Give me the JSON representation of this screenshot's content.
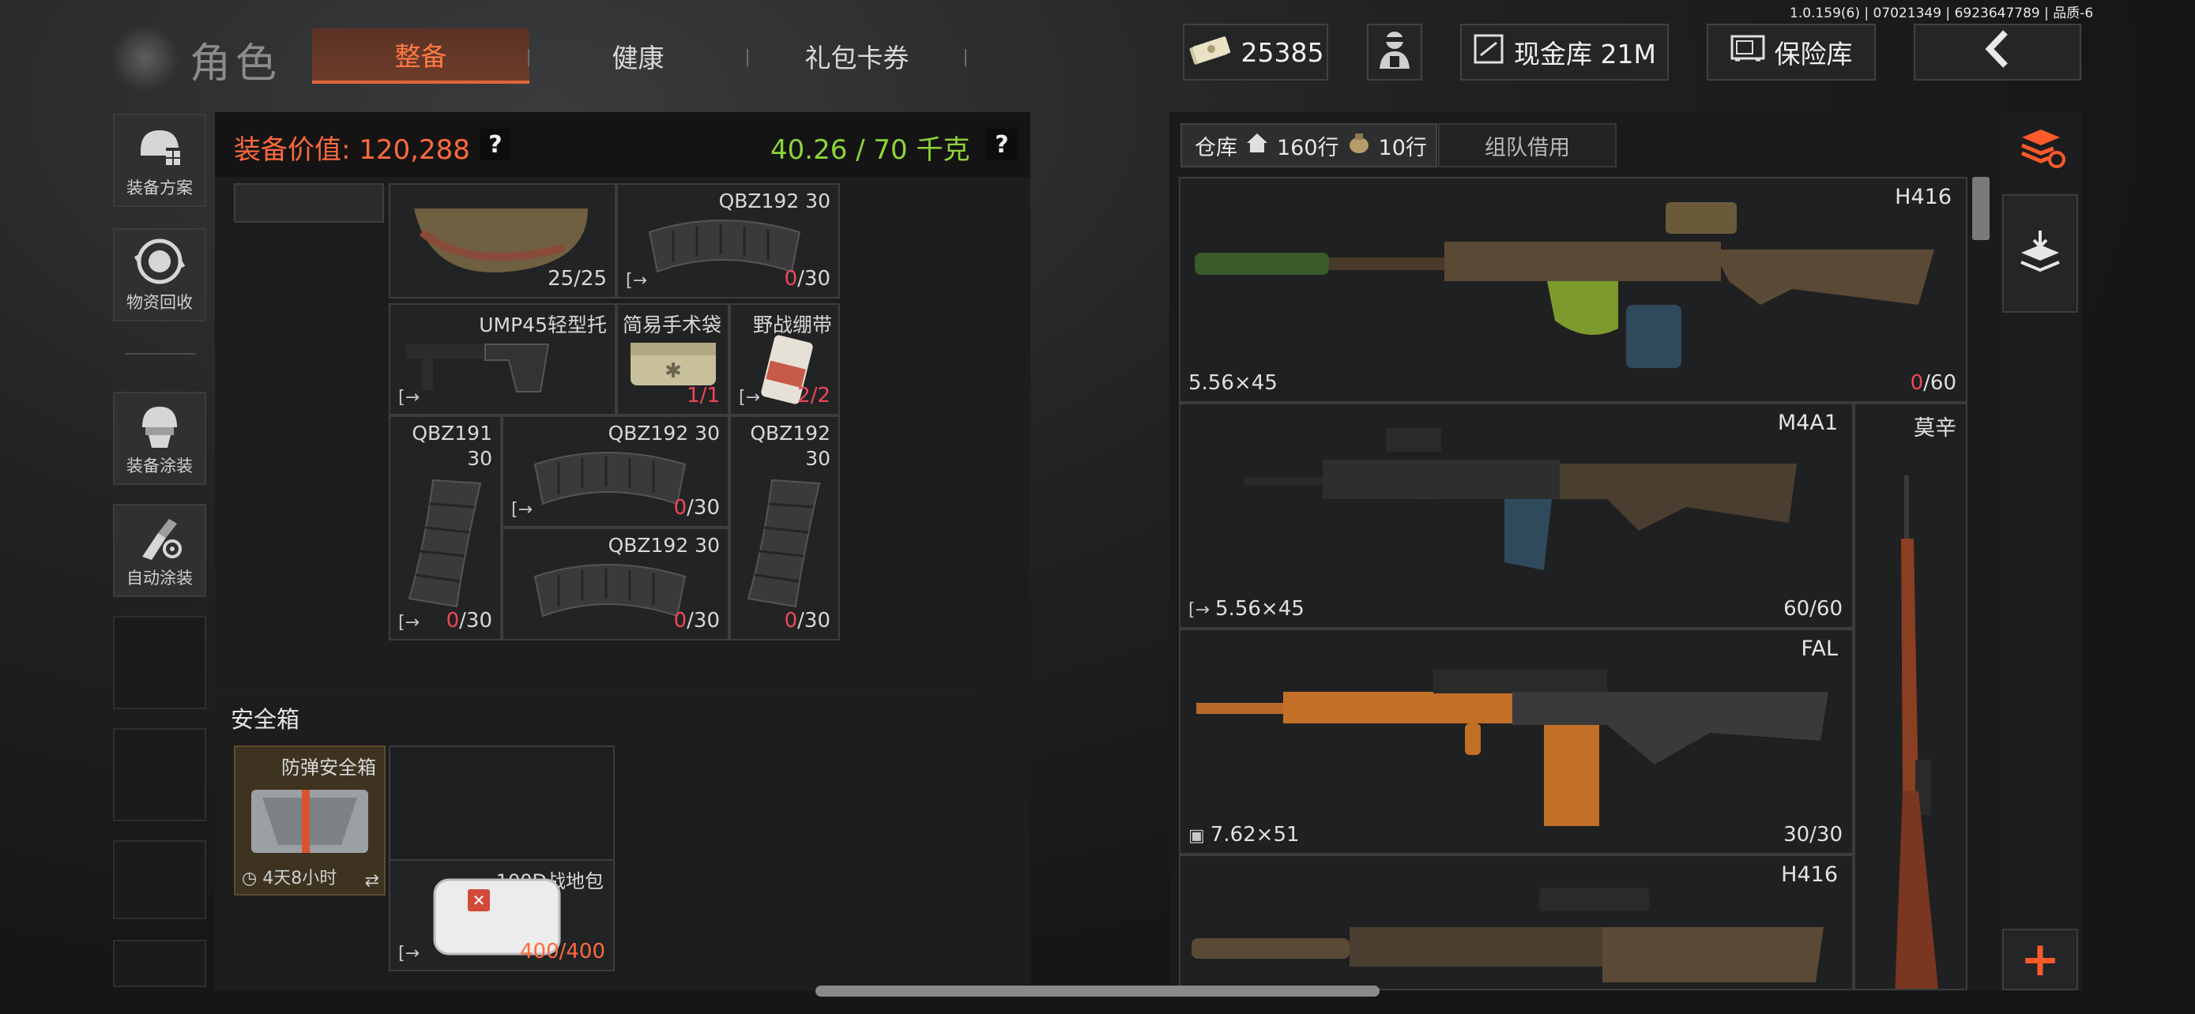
{
  "version_text": "1.0.159(6) | 07021349 | 6923647789 | 品质-6",
  "header": {
    "title": "角色",
    "tabs": [
      {
        "label": "整备",
        "active": true
      },
      {
        "label": "健康",
        "active": false
      },
      {
        "label": "礼包卡券",
        "active": false
      }
    ],
    "currency_amount": "25385",
    "cash_vault_label": "现金库 21M",
    "safe_label": "保险库",
    "back_icon": "chevron-left-icon"
  },
  "left_rail": {
    "buttons": [
      {
        "label": "装备方案",
        "icon": "loadout-icon"
      },
      {
        "label": "物资回收",
        "icon": "recycle-icon"
      },
      {
        "label": "装备涂装",
        "icon": "paint-gear-icon"
      },
      {
        "label": "自动涂装",
        "icon": "auto-paint-icon"
      }
    ]
  },
  "equipment": {
    "value_label": "装备价值: 120,288",
    "weight_label": "40.26 / 70 千克",
    "help_mark": "?",
    "helmet": {
      "count": "25/25"
    },
    "items": [
      {
        "name": "QBZ192 30",
        "current": "0",
        "max": "/30"
      },
      {
        "name": "UMP45轻型托"
      },
      {
        "name": "简易手术袋",
        "count": "1/1"
      },
      {
        "name": "野战绷带",
        "count": "2/2"
      },
      {
        "name": "QBZ191",
        "name2": "30",
        "current": "0",
        "max": "/30"
      },
      {
        "name": "QBZ192 30",
        "current": "0",
        "max": "/30"
      },
      {
        "name": "QBZ192",
        "name2": "30",
        "current": "0",
        "max": "/30"
      },
      {
        "name": "QBZ192 30",
        "current": "0",
        "max": "/30"
      }
    ]
  },
  "safe_box": {
    "section_title": "安全箱",
    "case_name": "防弹安全箱",
    "timer": "4天8小时",
    "bag_name": "100D战地包",
    "bag_count": "400/400"
  },
  "warehouse": {
    "tab_label": "仓库",
    "rows_house": "160行",
    "rows_bag": "10行",
    "team_tab": "组队借用",
    "weapons": [
      {
        "name": "H416",
        "caliber": "5.56×45",
        "ammo_current": "0",
        "ammo_max": "/60"
      },
      {
        "name": "M4A1",
        "caliber": "5.56×45",
        "ammo_current": "60",
        "ammo_max": "/60"
      },
      {
        "name": "FAL",
        "caliber": "7.62×51",
        "ammo_current": "30",
        "ammo_max": "/30"
      },
      {
        "name": "H416",
        "caliber": "",
        "ammo_current": "",
        "ammo_max": ""
      }
    ],
    "side_weapon": "莫辛",
    "add_symbol": "+"
  },
  "colors": {
    "accent": "#ff6a3d",
    "weight_ok": "#8fd43a",
    "ammo_empty": "#f0465a"
  }
}
